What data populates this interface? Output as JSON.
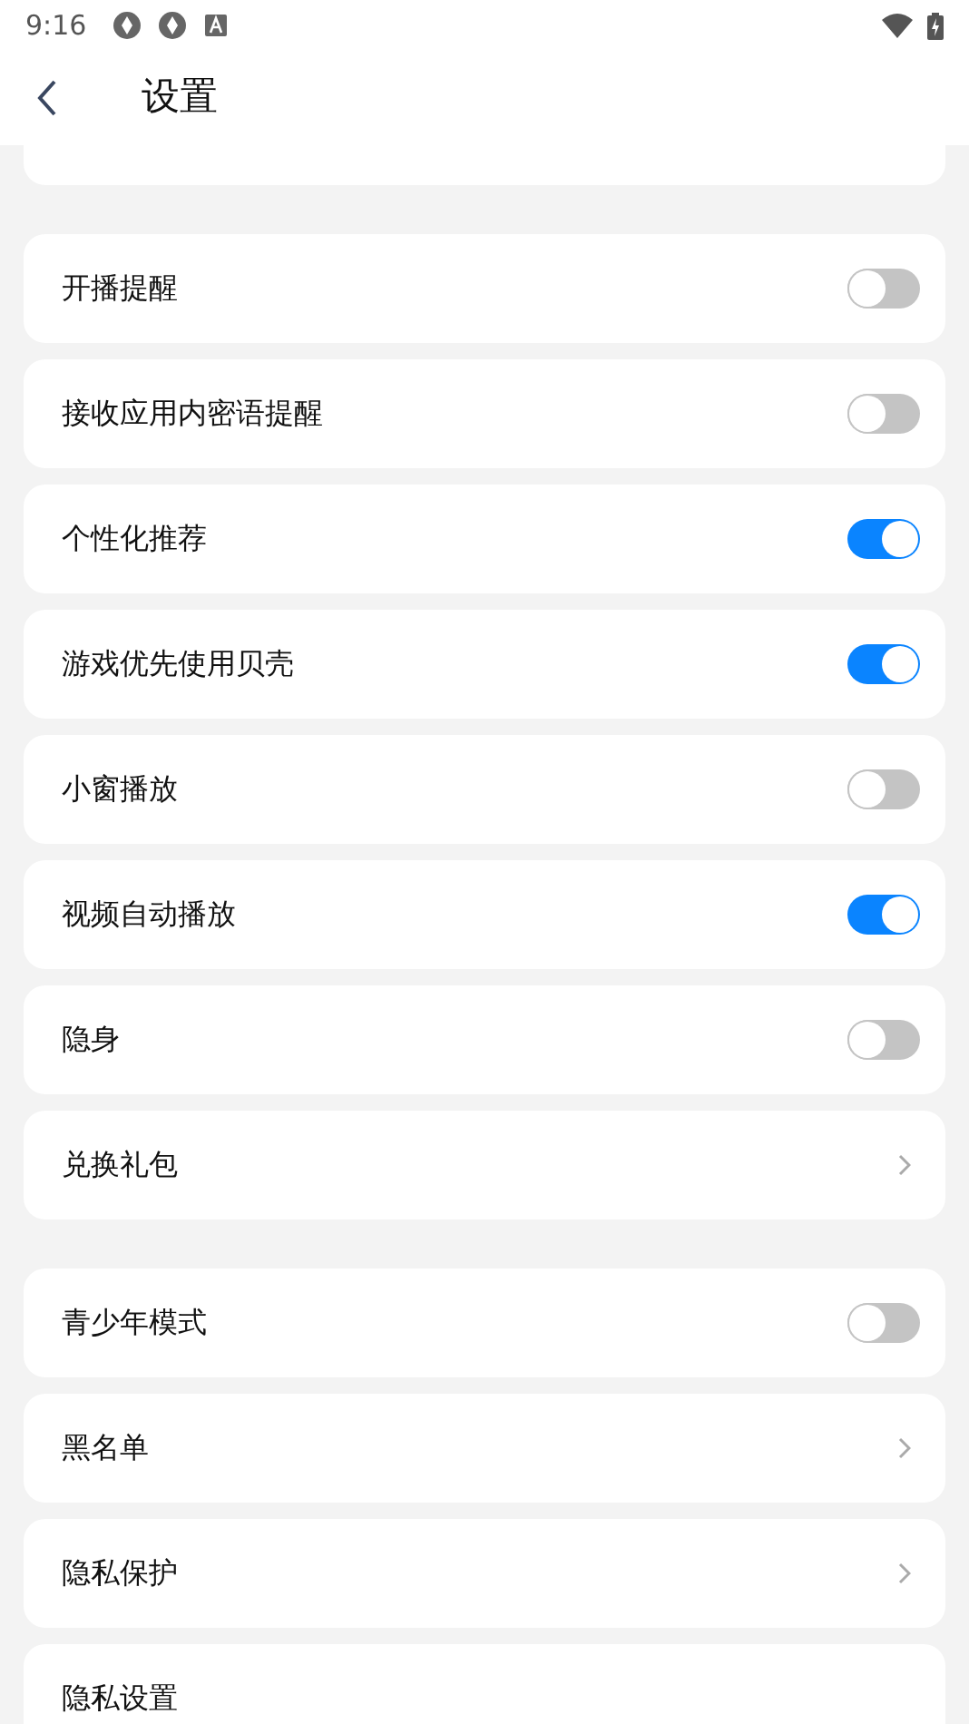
{
  "status_bar": {
    "time": "9:16"
  },
  "header": {
    "title": "设置"
  },
  "groups": [
    {
      "items": [
        {
          "kind": "toggle",
          "label": "开播提醒",
          "on": false
        },
        {
          "kind": "toggle",
          "label": "接收应用内密语提醒",
          "on": false
        },
        {
          "kind": "toggle",
          "label": "个性化推荐",
          "on": true
        },
        {
          "kind": "toggle",
          "label": "游戏优先使用贝壳",
          "on": true
        },
        {
          "kind": "toggle",
          "label": "小窗播放",
          "on": false
        },
        {
          "kind": "toggle",
          "label": "视频自动播放",
          "on": true
        },
        {
          "kind": "toggle",
          "label": "隐身",
          "on": false
        },
        {
          "kind": "link",
          "label": "兑换礼包"
        }
      ]
    },
    {
      "items": [
        {
          "kind": "toggle",
          "label": "青少年模式",
          "on": false
        },
        {
          "kind": "link",
          "label": "黑名单"
        },
        {
          "kind": "link",
          "label": "隐私保护"
        },
        {
          "kind": "plain",
          "label": "隐私设置"
        }
      ]
    }
  ]
}
